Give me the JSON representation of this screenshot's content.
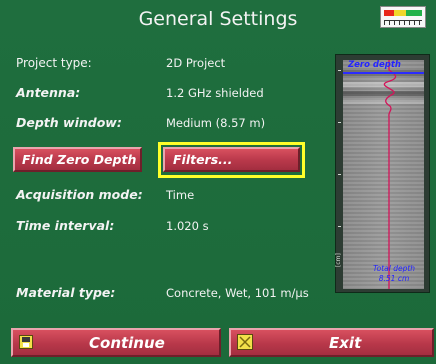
{
  "header": {
    "title": "General Settings"
  },
  "settings": {
    "project_type": {
      "label": "Project type:",
      "value": "2D Project"
    },
    "antenna": {
      "label": "Antenna:",
      "value": "1.2 GHz shielded"
    },
    "depth_window": {
      "label": "Depth window:",
      "value": "Medium (8.57 m)"
    },
    "acquisition_mode": {
      "label": "Acquisition mode:",
      "value": "Time"
    },
    "time_interval": {
      "label": "Time interval:",
      "value": "1.020 s"
    },
    "material_type": {
      "label": "Material type:",
      "value": "Concrete, Wet, 101 m/µs"
    }
  },
  "buttons": {
    "find_zero_depth": "Find Zero Depth",
    "filters": "Filters...",
    "continue": "Continue",
    "exit": "Exit"
  },
  "preview": {
    "zero_depth_label": "Zero depth",
    "total_depth_label": "Total depth",
    "total_depth_value": "8.51 cm",
    "unit_label": "[cm]"
  },
  "colors": {
    "background": "#1e6b3c",
    "button": "#b8384a",
    "focus_frame": "#ffff2a",
    "zero_depth_line": "#2b2bff",
    "trace": "#d4145a"
  },
  "icons": {
    "continue": "save-icon",
    "exit": "close-box-icon",
    "status": "battery-level-icon"
  }
}
